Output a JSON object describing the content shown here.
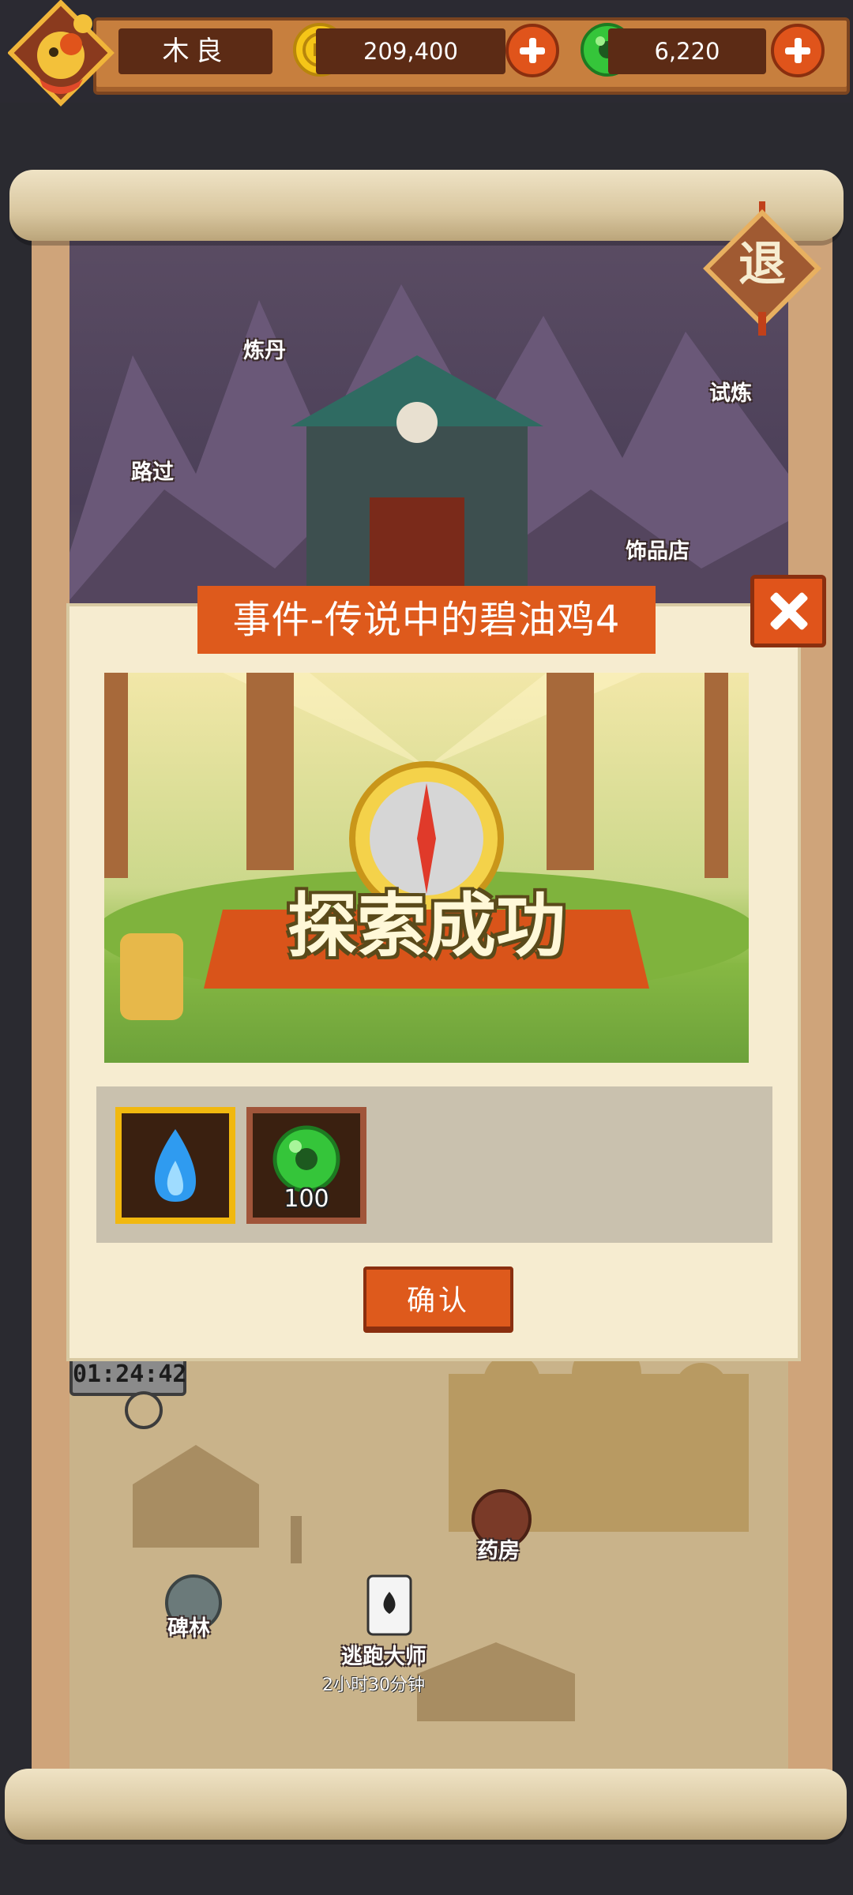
{
  "header": {
    "player_name": "木良",
    "coins": "209,400",
    "jade": "6,220"
  },
  "exit_button": {
    "label": "退"
  },
  "map_locations": {
    "alchemy": "炼丹",
    "passing": "路过",
    "trial": "试炼",
    "accessory_shop": "饰品店",
    "pharmacy": "药房",
    "stele_forest": "碑林",
    "escape_master": "逃跑大师",
    "escape_timer": "2小时30分钟",
    "countdown": "01:24:42"
  },
  "dialog": {
    "title": "事件-传说中的碧油鸡4",
    "banner_text": "探索成功",
    "rewards": [
      {
        "icon": "blue-flame-icon",
        "quantity": ""
      },
      {
        "icon": "jade-icon",
        "quantity": "100"
      }
    ],
    "confirm_label": "确认"
  },
  "colors": {
    "accent_orange": "#de5a1c",
    "panel_cream": "#f6ecd0",
    "gold_frame": "#f1b80f"
  }
}
